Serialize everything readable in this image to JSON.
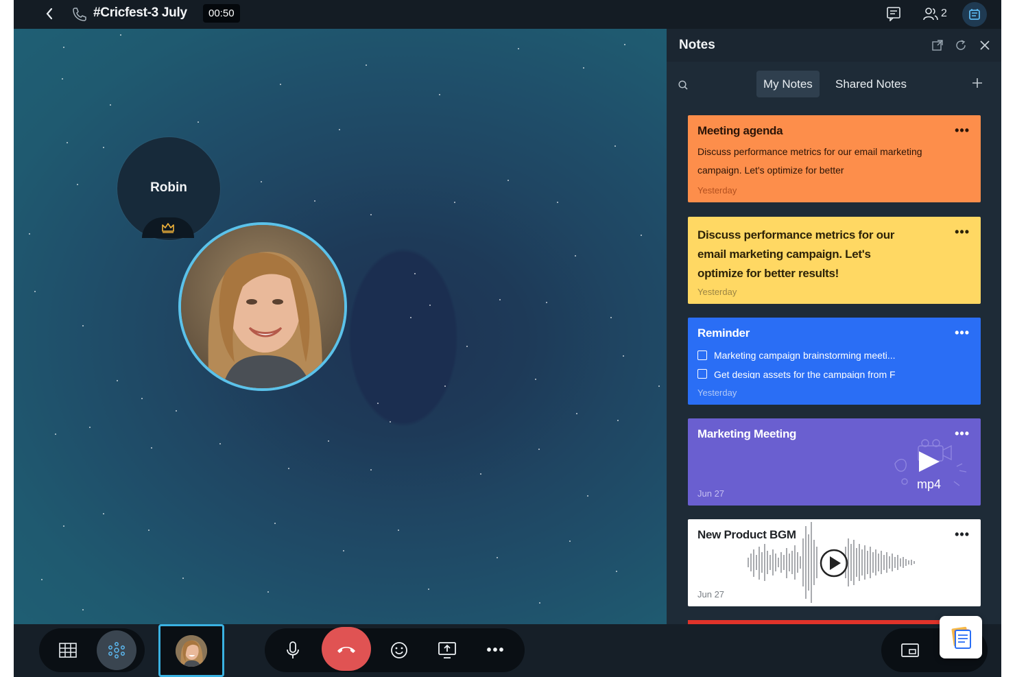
{
  "topbar": {
    "title": "#Cricfest-3 July",
    "timer": "00:50",
    "participant_count": "2"
  },
  "stage": {
    "host_name": "Robin"
  },
  "notes_panel": {
    "title": "Notes",
    "tabs": [
      {
        "label": "My Notes",
        "active": true
      },
      {
        "label": "Shared Notes",
        "active": false
      }
    ],
    "cards": [
      {
        "title": "Meeting agenda",
        "body": " Discuss performance metrics for our email marketing campaign. Let's optimize for better",
        "date": "Yesterday",
        "color": "#fd8e4b"
      },
      {
        "title": "Discuss performance metrics for our email marketing campaign. Let's optimize for better results!",
        "date": "Yesterday",
        "color": "#ffd863"
      },
      {
        "title": "Reminder",
        "checklist": [
          "Marketing campaign brainstorming meeti...",
          "Get design assets for the campaign from F"
        ],
        "date": "Yesterday",
        "color": "#2a6ef5"
      },
      {
        "title": "Marketing Meeting",
        "media_label": "mp4",
        "date": "Jun 27",
        "color": "#6a5fd0"
      },
      {
        "title": "New Product BGM",
        "date": "Jun 27",
        "color": "#ffffff"
      }
    ],
    "more_label": "•••"
  },
  "bottombar": {
    "more_label": "•••"
  },
  "colors": {
    "accent": "#3ab2e2",
    "end_call": "#e05353",
    "panel_bg": "#1e2b37"
  }
}
